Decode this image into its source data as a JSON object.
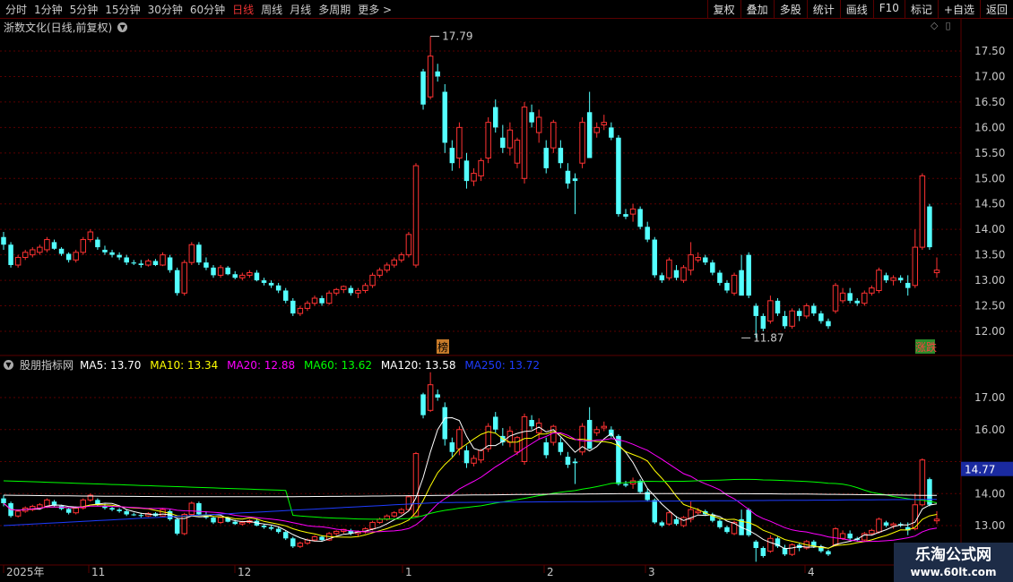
{
  "toolbar": {
    "periods": [
      "分时",
      "1分钟",
      "5分钟",
      "15分钟",
      "30分钟",
      "60分钟",
      "日线",
      "周线",
      "月线",
      "多周期",
      "更多"
    ],
    "active_period": "日线",
    "tools": [
      "复权",
      "叠加",
      "多股",
      "统计",
      "画线",
      "F10",
      "标记",
      "+自选",
      "返回"
    ]
  },
  "stock_title": "浙数文化(日线,前复权)",
  "price_axis": {
    "top_ticks": [
      "17.50",
      "17.00",
      "16.50",
      "16.00",
      "15.50",
      "15.00",
      "14.50",
      "14.00",
      "13.50",
      "13.00",
      "12.50",
      "12.00"
    ],
    "bottom_ticks": [
      "17.00",
      "16.00",
      "14.00",
      "13.00"
    ],
    "current_label": "14.77"
  },
  "annotations": {
    "high": "17.79",
    "low": "11.87",
    "badge_bang": "榜",
    "badge_rise_fall": "涨跌"
  },
  "indicator": {
    "name": "股朋指标网",
    "items": [
      {
        "label": "MA5:",
        "value": "13.70",
        "color": "#ffffff"
      },
      {
        "label": "MA10:",
        "value": "13.34",
        "color": "#ffff00"
      },
      {
        "label": "MA20:",
        "value": "12.88",
        "color": "#ff00ff"
      },
      {
        "label": "MA60:",
        "value": "13.62",
        "color": "#00ff00"
      },
      {
        "label": "MA120:",
        "value": "13.58",
        "color": "#ffffff"
      },
      {
        "label": "MA250:",
        "value": "13.72",
        "color": "#1e3cff"
      }
    ]
  },
  "date_axis": [
    "2025年",
    "11",
    "12",
    "1",
    "2",
    "3",
    "4"
  ],
  "watermark": {
    "line1": "乐淘公式网",
    "line2": "www.60lt.com"
  },
  "colors": {
    "up": "#ff3232",
    "down": "#54ffff",
    "grid": "#5a0000",
    "axis_text": "#c8c8c8"
  },
  "chart_data": {
    "type": "candlestick",
    "ohlc": [
      [
        13.85,
        13.95,
        13.6,
        13.7
      ],
      [
        13.7,
        13.75,
        13.25,
        13.3
      ],
      [
        13.3,
        13.5,
        13.25,
        13.45
      ],
      [
        13.45,
        13.6,
        13.4,
        13.55
      ],
      [
        13.5,
        13.65,
        13.45,
        13.6
      ],
      [
        13.55,
        13.7,
        13.5,
        13.65
      ],
      [
        13.6,
        13.85,
        13.55,
        13.8
      ],
      [
        13.75,
        13.8,
        13.6,
        13.62
      ],
      [
        13.62,
        13.65,
        13.48,
        13.52
      ],
      [
        13.52,
        13.55,
        13.35,
        13.4
      ],
      [
        13.4,
        13.6,
        13.35,
        13.55
      ],
      [
        13.55,
        13.85,
        13.5,
        13.8
      ],
      [
        13.8,
        14.0,
        13.75,
        13.95
      ],
      [
        13.8,
        13.85,
        13.6,
        13.65
      ],
      [
        13.6,
        13.68,
        13.5,
        13.55
      ],
      [
        13.55,
        13.6,
        13.45,
        13.5
      ],
      [
        13.5,
        13.55,
        13.4,
        13.45
      ],
      [
        13.45,
        13.5,
        13.3,
        13.35
      ],
      [
        13.35,
        13.4,
        13.3,
        13.33
      ],
      [
        13.33,
        13.4,
        13.25,
        13.3
      ],
      [
        13.3,
        13.42,
        13.27,
        13.38
      ],
      [
        13.38,
        13.42,
        13.28,
        13.3
      ],
      [
        13.3,
        13.55,
        13.28,
        13.5
      ],
      [
        13.45,
        13.5,
        13.15,
        13.2
      ],
      [
        13.2,
        13.25,
        12.7,
        12.75
      ],
      [
        12.75,
        13.4,
        12.7,
        13.35
      ],
      [
        13.35,
        13.75,
        13.3,
        13.7
      ],
      [
        13.7,
        13.75,
        13.3,
        13.35
      ],
      [
        13.35,
        13.45,
        13.2,
        13.25
      ],
      [
        13.25,
        13.3,
        13.05,
        13.1
      ],
      [
        13.1,
        13.3,
        13.05,
        13.25
      ],
      [
        13.25,
        13.28,
        13.1,
        13.12
      ],
      [
        13.12,
        13.18,
        13.02,
        13.05
      ],
      [
        13.05,
        13.15,
        13.0,
        13.1
      ],
      [
        13.1,
        13.2,
        13.05,
        13.15
      ],
      [
        13.15,
        13.2,
        12.98,
        13.0
      ],
      [
        13.0,
        13.05,
        12.9,
        12.95
      ],
      [
        12.95,
        13.0,
        12.85,
        12.9
      ],
      [
        12.9,
        12.95,
        12.75,
        12.8
      ],
      [
        12.8,
        12.85,
        12.55,
        12.6
      ],
      [
        12.6,
        12.65,
        12.3,
        12.35
      ],
      [
        12.35,
        12.5,
        12.3,
        12.45
      ],
      [
        12.45,
        12.6,
        12.4,
        12.55
      ],
      [
        12.55,
        12.7,
        12.5,
        12.65
      ],
      [
        12.65,
        12.7,
        12.5,
        12.55
      ],
      [
        12.55,
        12.8,
        12.52,
        12.75
      ],
      [
        12.75,
        12.85,
        12.7,
        12.82
      ],
      [
        12.82,
        12.9,
        12.75,
        12.88
      ],
      [
        12.85,
        12.9,
        12.7,
        12.75
      ],
      [
        12.75,
        12.85,
        12.65,
        12.8
      ],
      [
        12.8,
        12.95,
        12.75,
        12.9
      ],
      [
        12.9,
        13.15,
        12.85,
        13.1
      ],
      [
        13.1,
        13.25,
        13.05,
        13.2
      ],
      [
        13.2,
        13.35,
        13.15,
        13.3
      ],
      [
        13.3,
        13.45,
        13.25,
        13.4
      ],
      [
        13.4,
        13.55,
        13.35,
        13.5
      ],
      [
        13.5,
        13.95,
        13.45,
        13.9
      ],
      [
        13.3,
        15.3,
        13.25,
        15.25
      ],
      [
        17.1,
        17.15,
        16.35,
        16.45
      ],
      [
        16.6,
        17.79,
        16.55,
        17.4
      ],
      [
        17.1,
        17.25,
        16.9,
        17.0
      ],
      [
        16.7,
        16.85,
        15.5,
        15.7
      ],
      [
        15.6,
        15.75,
        15.15,
        15.3
      ],
      [
        15.4,
        16.1,
        15.2,
        16.0
      ],
      [
        15.35,
        15.5,
        14.8,
        14.95
      ],
      [
        14.95,
        15.2,
        14.85,
        15.1
      ],
      [
        15.05,
        15.4,
        14.95,
        15.35
      ],
      [
        15.4,
        16.2,
        15.3,
        16.1
      ],
      [
        16.4,
        16.55,
        15.9,
        16.0
      ],
      [
        15.8,
        16.05,
        15.5,
        15.6
      ],
      [
        15.6,
        16.1,
        15.45,
        15.95
      ],
      [
        15.3,
        15.8,
        15.2,
        15.75
      ],
      [
        15.0,
        16.5,
        14.9,
        16.4
      ],
      [
        16.3,
        16.45,
        16.0,
        16.1
      ],
      [
        15.9,
        16.35,
        15.7,
        16.2
      ],
      [
        15.6,
        15.75,
        15.1,
        15.2
      ],
      [
        15.6,
        16.15,
        15.5,
        16.1
      ],
      [
        15.6,
        15.75,
        15.2,
        15.3
      ],
      [
        15.15,
        15.3,
        14.8,
        14.9
      ],
      [
        15.0,
        15.1,
        14.3,
        14.95
      ],
      [
        15.3,
        16.2,
        15.2,
        16.1
      ],
      [
        16.3,
        16.7,
        15.4,
        15.4
      ],
      [
        15.9,
        16.1,
        15.8,
        16.0
      ],
      [
        16.05,
        16.25,
        15.95,
        16.1
      ],
      [
        16.0,
        16.1,
        15.75,
        15.8
      ],
      [
        15.8,
        15.85,
        14.25,
        14.3
      ],
      [
        14.3,
        14.4,
        14.2,
        14.25
      ],
      [
        14.3,
        14.5,
        14.15,
        14.4
      ],
      [
        14.4,
        14.45,
        14.0,
        14.05
      ],
      [
        14.05,
        14.15,
        13.75,
        13.8
      ],
      [
        13.8,
        13.85,
        13.05,
        13.1
      ],
      [
        13.1,
        13.15,
        12.95,
        13.0
      ],
      [
        13.05,
        13.45,
        13.0,
        13.4
      ],
      [
        13.2,
        13.3,
        13.0,
        13.05
      ],
      [
        13.0,
        13.3,
        12.95,
        13.25
      ],
      [
        13.2,
        13.75,
        13.1,
        13.5
      ],
      [
        13.4,
        13.55,
        13.35,
        13.45
      ],
      [
        13.45,
        13.5,
        13.3,
        13.35
      ],
      [
        13.35,
        13.4,
        13.1,
        13.15
      ],
      [
        13.15,
        13.2,
        12.9,
        12.95
      ],
      [
        12.95,
        13.0,
        12.75,
        12.8
      ],
      [
        12.75,
        13.15,
        12.7,
        13.1
      ],
      [
        13.2,
        13.5,
        13.1,
        12.7
      ],
      [
        13.5,
        13.55,
        12.65,
        12.7
      ],
      [
        12.5,
        12.55,
        11.87,
        12.3
      ],
      [
        12.3,
        12.35,
        12.0,
        12.05
      ],
      [
        12.2,
        12.7,
        12.15,
        12.6
      ],
      [
        12.6,
        12.65,
        12.3,
        12.35
      ],
      [
        12.3,
        12.4,
        12.05,
        12.1
      ],
      [
        12.1,
        12.45,
        12.05,
        12.4
      ],
      [
        12.4,
        12.45,
        12.2,
        12.3
      ],
      [
        12.3,
        12.55,
        12.25,
        12.5
      ],
      [
        12.5,
        12.55,
        12.3,
        12.35
      ],
      [
        12.35,
        12.4,
        12.15,
        12.2
      ],
      [
        12.2,
        12.25,
        12.05,
        12.1
      ],
      [
        12.4,
        12.95,
        12.35,
        12.9
      ],
      [
        12.6,
        12.85,
        12.55,
        12.75
      ],
      [
        12.75,
        12.85,
        12.55,
        12.6
      ],
      [
        12.6,
        12.65,
        12.5,
        12.55
      ],
      [
        12.55,
        12.8,
        12.5,
        12.75
      ],
      [
        12.75,
        12.9,
        12.7,
        12.85
      ],
      [
        12.8,
        13.25,
        12.75,
        13.2
      ],
      [
        13.1,
        13.15,
        12.95,
        13.0
      ],
      [
        13.0,
        13.1,
        12.9,
        13.05
      ],
      [
        13.05,
        13.1,
        12.95,
        13.0
      ],
      [
        12.95,
        13.1,
        12.7,
        12.85
      ],
      [
        12.9,
        14.0,
        12.85,
        13.65
      ],
      [
        13.65,
        15.1,
        13.6,
        15.05
      ],
      [
        14.45,
        14.5,
        13.6,
        13.65
      ],
      [
        13.15,
        13.45,
        13.05,
        13.2
      ]
    ],
    "high_label": 17.79,
    "low_label": 11.87,
    "ma_values": {
      "MA5": 13.7,
      "MA10": 13.34,
      "MA20": 12.88,
      "MA60": 13.62,
      "MA120": 13.58,
      "MA250": 13.72
    }
  }
}
